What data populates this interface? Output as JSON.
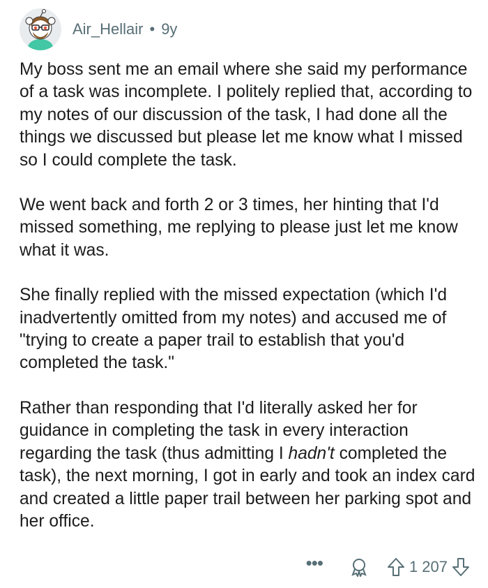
{
  "comment": {
    "username": "Air_Hellair",
    "separator": "•",
    "age": "9y",
    "paragraphs": {
      "p1": "My boss sent me an email where she said my performance of a task was incomplete. I politely replied that, according to my notes of our discussion of the task, I had done all the things we discussed but please let me know what I missed so I could complete the task.",
      "p2": "We went back and forth 2 or 3 times, her hinting that I'd missed something, me replying to please just let me know what it was.",
      "p3": "She finally replied with the missed expectation (which I'd inadvertently omitted from my notes) and accused me of \"trying to create a paper trail to establish that you'd completed the task.\"",
      "p4_before": "Rather than responding that I'd literally asked her for guidance in completing the task in every interaction regarding the task (thus admitting I ",
      "p4_italic": "hadn't",
      "p4_after": " completed the task), the next morning, I got in early and took an index card and created a little paper trail between her parking spot and her office."
    }
  },
  "actions": {
    "more_label": "•••",
    "score": "1 207"
  },
  "icons": {
    "avatar": "snoo-avatar",
    "award": "award-icon",
    "upvote": "upvote-arrow-icon",
    "downvote": "downvote-arrow-icon"
  }
}
